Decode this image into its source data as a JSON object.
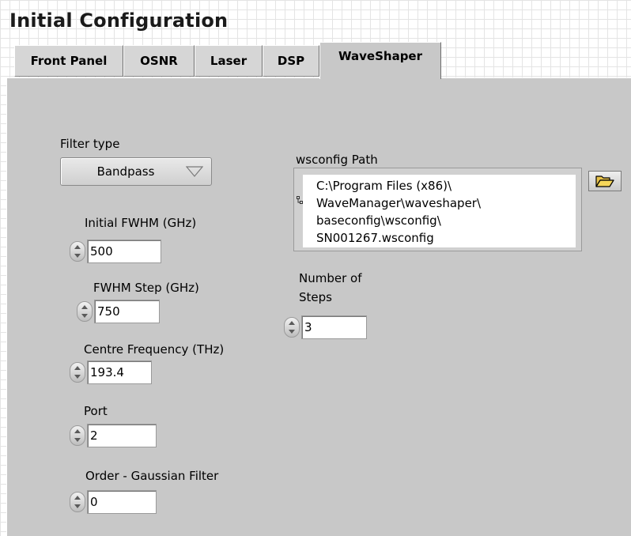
{
  "window": {
    "title": "Initial Configuration"
  },
  "tabs": [
    {
      "label": "Front Panel"
    },
    {
      "label": "OSNR"
    },
    {
      "label": "Laser"
    },
    {
      "label": "DSP"
    },
    {
      "label": "WaveShaper",
      "active": true
    }
  ],
  "filter_type": {
    "label": "Filter type",
    "value": "Bandpass"
  },
  "initial_fwhm": {
    "label": "Initial FWHM (GHz)",
    "value": "500"
  },
  "fwhm_step": {
    "label": "FWHM Step (GHz)",
    "value": "750"
  },
  "centre_frequency": {
    "label": "Centre Frequency (THz)",
    "value": "193.4"
  },
  "port": {
    "label": "Port",
    "value": "2"
  },
  "order_gaussian": {
    "label": "Order - Gaussian Filter",
    "value": "0"
  },
  "wsconfig_path": {
    "label": "wsconfig Path",
    "lines": [
      "C:\\Program Files (x86)\\",
      "WaveManager\\waveshaper\\",
      "baseconfig\\wsconfig\\",
      "SN001267.wsconfig"
    ]
  },
  "number_of_steps": {
    "label_line1": "Number of",
    "label_line2": "Steps",
    "value": "3"
  },
  "icons": {
    "browse": "folder-open-icon",
    "spinner": "increment-decrement-icon",
    "path": "path-indicator-icon"
  }
}
